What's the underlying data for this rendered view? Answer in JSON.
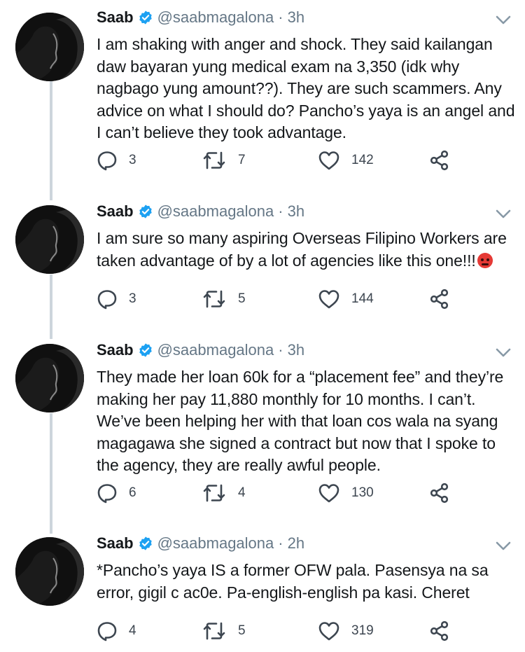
{
  "tweets": [
    {
      "name": "Saab",
      "handle": "@saabmagalona",
      "separator": "·",
      "time": "3h",
      "text": "I am shaking with anger and shock. They said kailangan daw bayaran yung medical exam na 3,350 (idk why nagbago yung amount??). They are such scammers. Any advice on what I should do? Pancho’s yaya is an angel and I can’t believe they took advantage.",
      "replies": "3",
      "retweets": "7",
      "likes": "142"
    },
    {
      "name": "Saab",
      "handle": "@saabmagalona",
      "separator": "·",
      "time": "3h",
      "text": "I am sure so many aspiring Overseas Filipino Workers are taken advantage of by a lot of agencies like this one!!!",
      "emoji": "angry-face",
      "replies": "3",
      "retweets": "5",
      "likes": "144"
    },
    {
      "name": "Saab",
      "handle": "@saabmagalona",
      "separator": "·",
      "time": "3h",
      "text": "They made her loan 60k for a “placement fee” and they’re making her pay 11,880 monthly for 10 months. I can’t. We’ve been helping her with that loan cos wala na syang magagawa she signed a contract but now that I spoke to the agency, they are really awful people.",
      "replies": "6",
      "retweets": "4",
      "likes": "130"
    },
    {
      "name": "Saab",
      "handle": "@saabmagalona",
      "separator": "·",
      "time": "2h",
      "text": "*Pancho’s yaya IS a former OFW pala. Pasensya na sa error, gigil c ac0e. Pa-english-english pa kasi. Cheret",
      "replies": "4",
      "retweets": "5",
      "likes": "319"
    }
  ],
  "colors": {
    "verified": "#1da1f2",
    "icon": "#3d4650",
    "secondary_text": "#657786",
    "thread_line": "#cdd5dc"
  },
  "icons": [
    "verified-badge-icon",
    "chevron-down-icon",
    "reply-icon",
    "retweet-icon",
    "like-icon",
    "share-icon"
  ]
}
